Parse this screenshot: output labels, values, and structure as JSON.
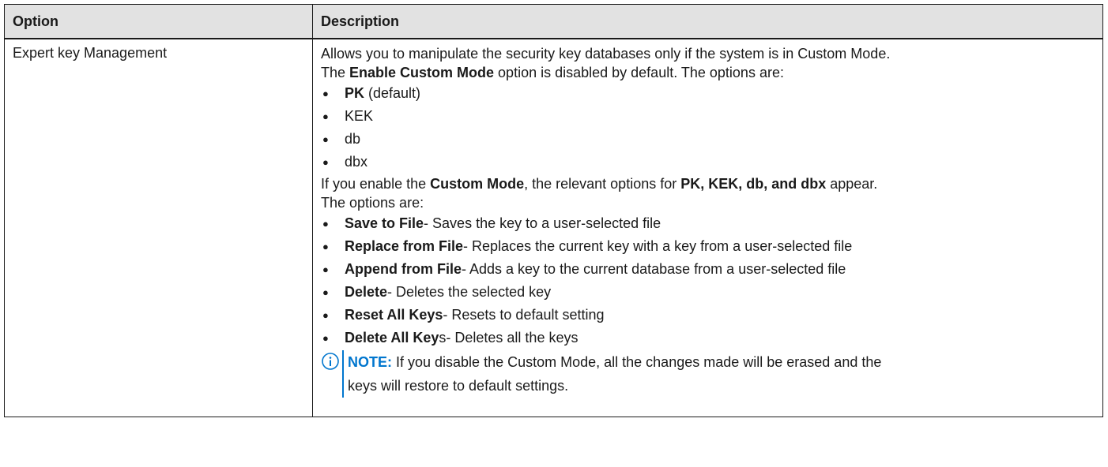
{
  "table": {
    "headers": [
      "Option",
      "Description"
    ],
    "row": {
      "option": "Expert key Management",
      "intro_line1": "Allows you to manipulate the security key databases only if the system is in Custom Mode.",
      "intro_line2_pre": "The ",
      "intro_line2_bold": "Enable Custom Mode",
      "intro_line2_post": " option is disabled by default. The options are:",
      "key_options": [
        {
          "bold": "PK",
          "text": " (default)"
        },
        {
          "bold": "",
          "text": "KEK"
        },
        {
          "bold": "",
          "text": "db"
        },
        {
          "bold": "",
          "text": "dbx"
        }
      ],
      "custom_line1_pre": "If you enable the ",
      "custom_line1_bold1": "Custom Mode",
      "custom_line1_mid": ", the relevant options for ",
      "custom_line1_bold2": "PK, KEK, db, and dbx",
      "custom_line1_post": " appear.",
      "custom_line2": "The options are:",
      "custom_options": [
        {
          "bold": "Save to File",
          "text": "- Saves the key to a user-selected file"
        },
        {
          "bold": "Replace from File",
          "text": "- Replaces the current key with a key from a user-selected file"
        },
        {
          "bold": "Append from File",
          "text": "- Adds a key to the current database from a user-selected file"
        },
        {
          "bold": "Delete",
          "text": "- Deletes the selected key"
        },
        {
          "bold": "Reset All Keys",
          "text": "- Resets to default setting"
        },
        {
          "bold": "Delete All Key",
          "text": "s- Deletes all the keys"
        }
      ],
      "note_label": "NOTE:",
      "note_line1": " If you disable the Custom Mode, all the changes made will be erased and the",
      "note_line2": "keys will restore to default settings."
    }
  },
  "colors": {
    "accent": "#0076ce",
    "header_bg": "#e2e2e2"
  },
  "icons": {
    "note": "info-circle-icon",
    "bullet": "bullet-dot"
  }
}
